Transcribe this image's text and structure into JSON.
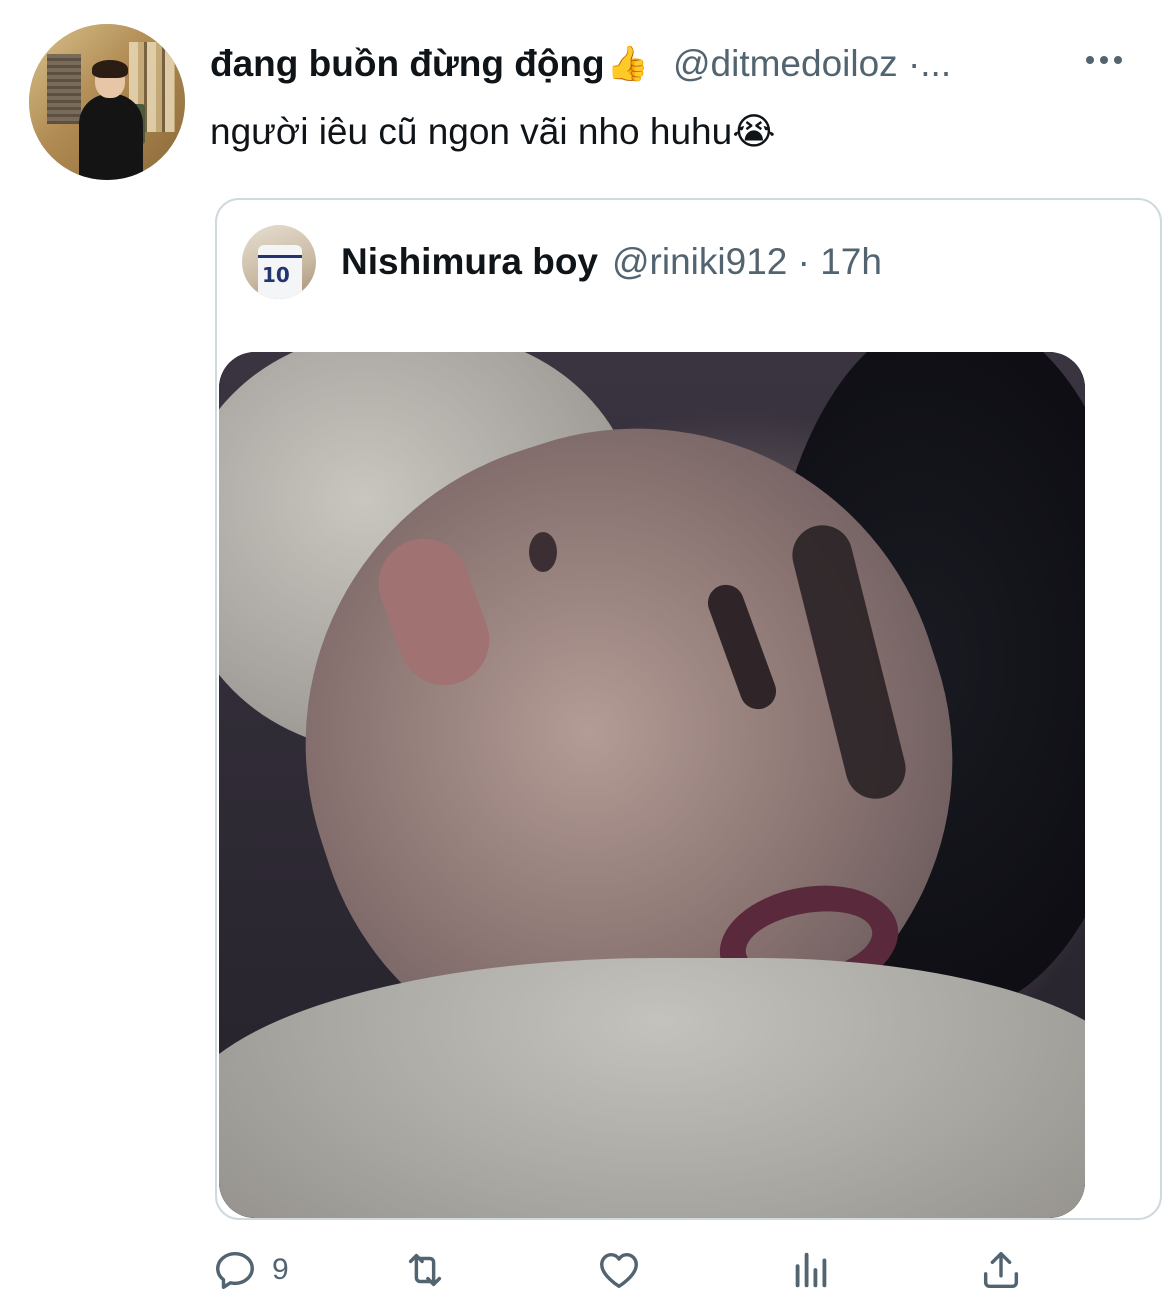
{
  "author": {
    "display_name": "đang buồn đừng động",
    "name_emoji": "👍",
    "handle": "@ditmedoiloz ·..."
  },
  "tweet": {
    "text": "người iêu cũ ngon vãi nho huhu",
    "text_emoji": "😭"
  },
  "quoted_tweet": {
    "display_name": "Nishimura boy",
    "handle_time": "@riniki912 · 17h",
    "avatar_jersey_number": "10"
  },
  "actions": {
    "reply_count": "9",
    "icons": [
      "reply-icon",
      "retweet-icon",
      "like-icon",
      "analytics-icon",
      "share-icon"
    ]
  },
  "colors": {
    "text": "#0f1419",
    "secondary": "#536471",
    "border": "#cfd9de"
  }
}
